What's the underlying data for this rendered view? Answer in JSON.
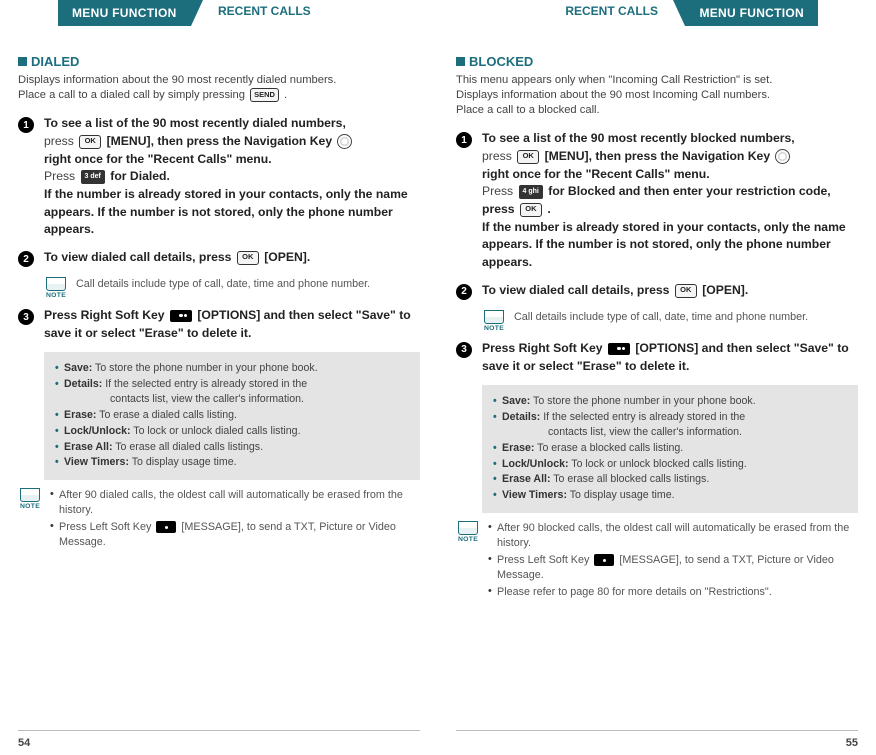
{
  "header": {
    "tab": "MENU FUNCTION",
    "subtitle": "RECENT CALLS"
  },
  "left": {
    "section_title": "DIALED",
    "intro_line1": "Displays information about the 90 most recently dialed numbers.",
    "intro_line2": "Place a call to a dialed call by simply pressing ",
    "intro_key": "SEND",
    "step1": {
      "l1a": "To see a list of the 90 most recently dialed numbers,",
      "l1b": "press ",
      "l1c": " [MENU], then press the Navigation Key ",
      "l1d": "right once for the \"Recent Calls\" menu.",
      "l1e": "Press ",
      "numkey": "3 def",
      "l1f": " for Dialed.",
      "l1g": "If the number is already stored in your contacts, only the name appears. If the number is not stored, only the phone number appears."
    },
    "step2": {
      "l": "To view dialed call details, press ",
      "tail": " [OPEN]."
    },
    "note1": "Call details include type of call, date, time and phone number.",
    "step3": {
      "l1": "Press Right Soft Key ",
      "l2": " [OPTIONS] and then select \"Save\" to save it or select \"Erase\" to delete it."
    },
    "opts": {
      "save": "Save:",
      "save_d": " To store the phone number in your phone book.",
      "details": "Details:",
      "details_d": " If the selected entry is already stored in the",
      "details_d2": "contacts list, view the caller's information.",
      "erase": "Erase:",
      "erase_d": " To erase a dialed calls listing.",
      "lock": "Lock/Unlock:",
      "lock_d": " To lock or unlock dialed calls listing.",
      "eraseall": "Erase All:",
      "eraseall_d": " To erase all dialed calls listings.",
      "timers": "View Timers:",
      "timers_d": " To display usage time."
    },
    "note2": {
      "a": "After 90 dialed calls, the oldest call will automatically be erased from the history.",
      "b1": "Press Left Soft Key ",
      "b2": " [MESSAGE], to send a TXT, Picture or Video Message."
    },
    "page": "54"
  },
  "right": {
    "section_title": "BLOCKED",
    "intro_line1": "This menu appears only when \"Incoming Call Restriction\" is set.",
    "intro_line2": "Displays information about the 90 most Incoming Call numbers.",
    "intro_line3": "Place a call to a blocked call.",
    "step1": {
      "l1a": "To see a list of the 90 most recently blocked numbers,",
      "l1b": "press ",
      "l1c": " [MENU], then press the Navigation Key ",
      "l1d": "right once for the \"Recent Calls\" menu.",
      "l1e": "Press ",
      "numkey": "4 ghi",
      "l1f": " for Blocked and then enter your restriction code, press ",
      "tailpunct": " .",
      "l1g": "If the number is already stored in your contacts, only the name appears. If the number is not stored, only the phone number appears."
    },
    "step2": {
      "l": "To view dialed call details, press ",
      "tail": " [OPEN]."
    },
    "note1": "Call details include type of call, date, time and phone number.",
    "step3": {
      "l1": "Press Right Soft Key ",
      "l2": " [OPTIONS] and then select \"Save\" to save it or select \"Erase\" to delete it."
    },
    "opts": {
      "save": "Save:",
      "save_d": " To store the phone number in your phone book.",
      "details": "Details:",
      "details_d": " If the selected entry is already stored in the",
      "details_d2": "contacts list, view the caller's information.",
      "erase": "Erase:",
      "erase_d": " To erase a blocked calls listing.",
      "lock": "Lock/Unlock:",
      "lock_d": " To lock or unlock blocked calls listing.",
      "eraseall": "Erase All:",
      "eraseall_d": " To erase all blocked calls listings.",
      "timers": "View Timers:",
      "timers_d": " To display usage time."
    },
    "note2": {
      "a": "After 90 blocked calls, the oldest call will automatically be erased from the history.",
      "b1": "Press Left Soft Key ",
      "b2": " [MESSAGE], to send a TXT, Picture or Video Message.",
      "c": "Please refer to page 80 for more details on \"Restrictions\"."
    },
    "page": "55"
  },
  "keys": {
    "ok": "OK",
    "send": "SEND"
  },
  "noteLabel": "NOTE"
}
